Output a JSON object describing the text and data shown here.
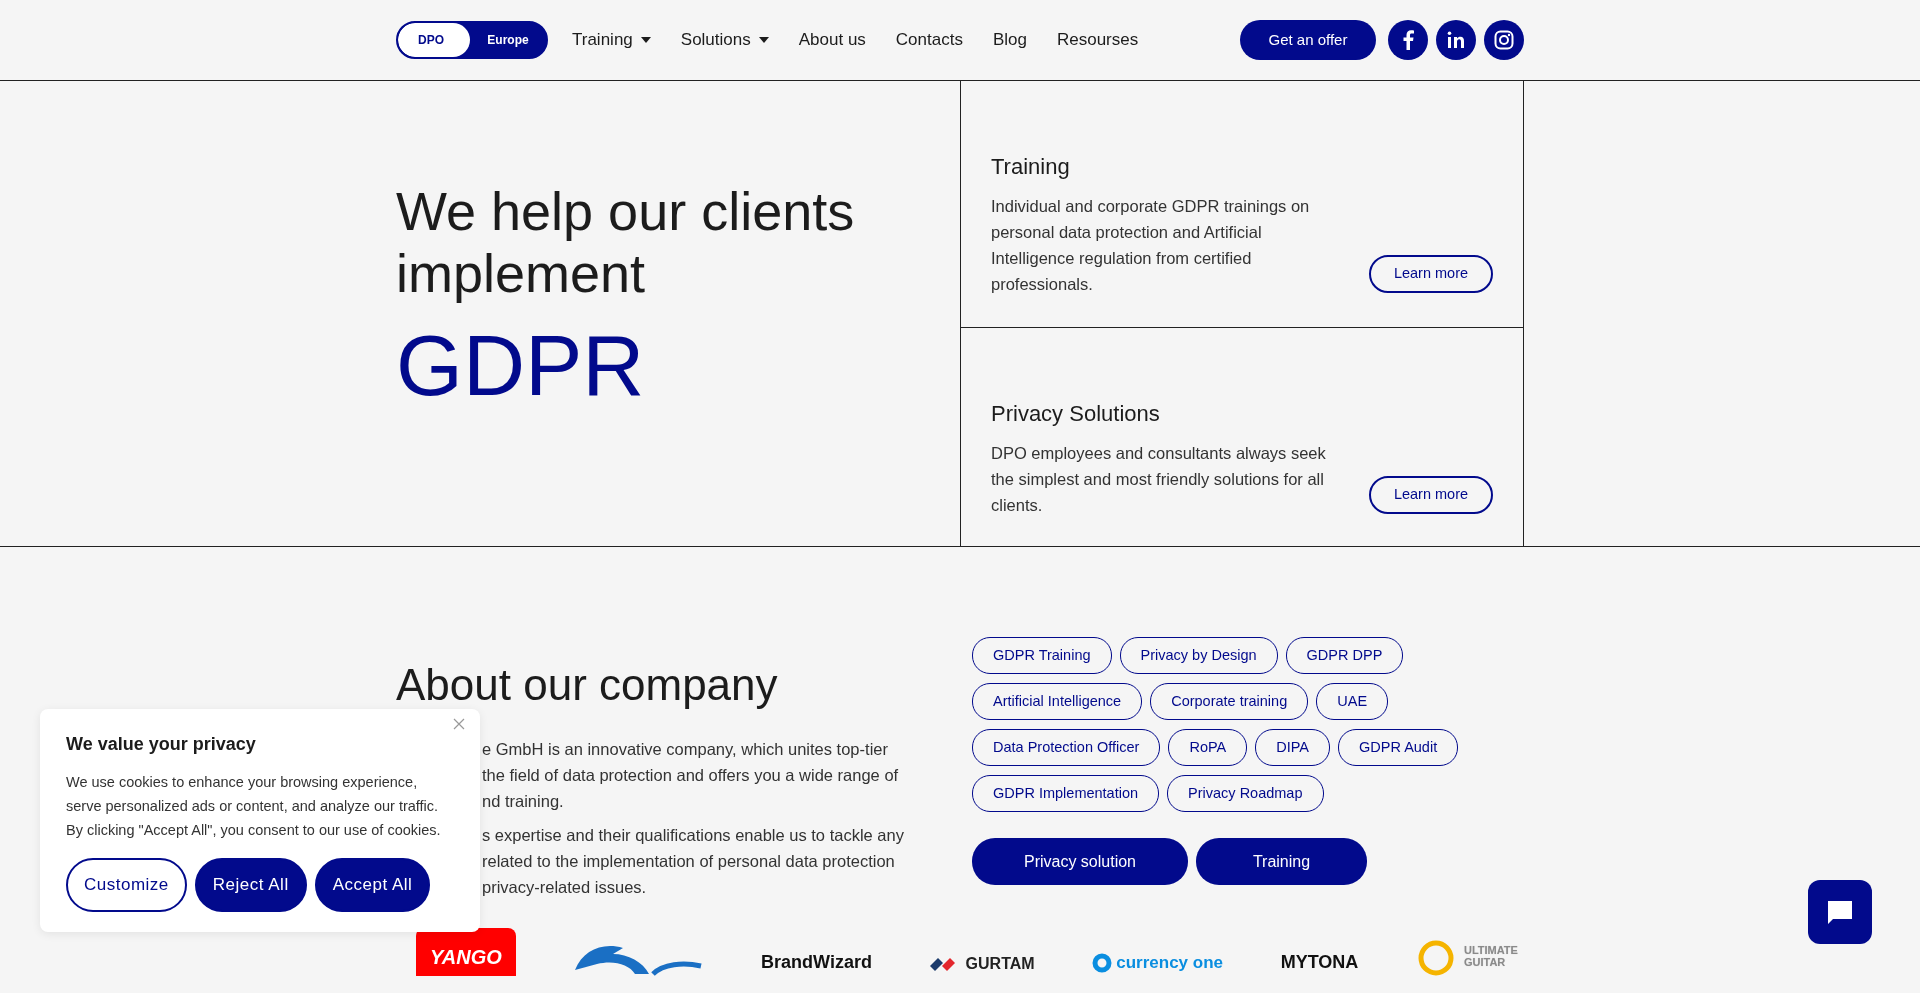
{
  "header": {
    "logo": {
      "left": "DPO",
      "right": "Europe"
    },
    "nav": [
      {
        "label": "Training",
        "dropdown": true
      },
      {
        "label": "Solutions",
        "dropdown": true
      },
      {
        "label": "About us",
        "dropdown": false
      },
      {
        "label": "Contacts",
        "dropdown": false
      },
      {
        "label": "Blog",
        "dropdown": false
      },
      {
        "label": "Resourses",
        "dropdown": false
      }
    ],
    "cta": "Get an offer",
    "social": [
      {
        "kind": "facebook"
      },
      {
        "kind": "linkedin"
      },
      {
        "kind": "instagram"
      }
    ]
  },
  "hero": {
    "heading": "We help our clients implement",
    "highlight": "GDPR",
    "cards": [
      {
        "title": "Training",
        "text": "Individual and corporate GDPR trainings on personal data protection and Artificial Intelligence regulation from certified professionals.",
        "button": "Learn more"
      },
      {
        "title": "Privacy Solutions",
        "text": "DPO employees and consultants always seek the simplest and most friendly solutions for all clients.",
        "button": "Learn more"
      }
    ]
  },
  "about": {
    "heading": "About our company",
    "paragraphs": [
      [
        "e GmbH is an innovative company, which unites top-tier",
        "the field of data protection and offers you a wide range of",
        "nd training."
      ],
      [
        "s expertise and their qualifications enable us to tackle any",
        "related to the implementation of personal data protection",
        "privacy-related issues."
      ]
    ],
    "tags": [
      "GDPR Training",
      "Privacy by Design",
      "GDPR DPP",
      "Artificial Intelligence",
      "Corporate training",
      "UAE",
      "Data Protection Officer",
      "RoPA",
      "DIPA",
      "GDPR Audit",
      "GDPR Implementation",
      "Privacy Roadmap"
    ],
    "buttons": [
      "Privacy solution",
      "Training"
    ]
  },
  "logos": [
    {
      "kind": "yango",
      "text": "YANGO"
    },
    {
      "kind": "bird"
    },
    {
      "kind": "plain",
      "text": "BrandWizard"
    },
    {
      "kind": "gurtam",
      "text": "GURTAM"
    },
    {
      "kind": "currency",
      "text": "currency one"
    },
    {
      "kind": "plain",
      "text": "MYTONA"
    },
    {
      "kind": "guitar",
      "text": "ULTIMATE GUITAR"
    }
  ],
  "cookie_banner": {
    "title": "We value your privacy",
    "text": "We use cookies to enhance your browsing experience, serve personalized ads or content, and analyze our traffic. By clicking \"Accept All\", you consent to our use of cookies.",
    "buttons": [
      {
        "label": "Customize",
        "kind": "outline"
      },
      {
        "label": "Reject All",
        "kind": "solid"
      },
      {
        "label": "Accept All",
        "kind": "solid"
      }
    ]
  }
}
